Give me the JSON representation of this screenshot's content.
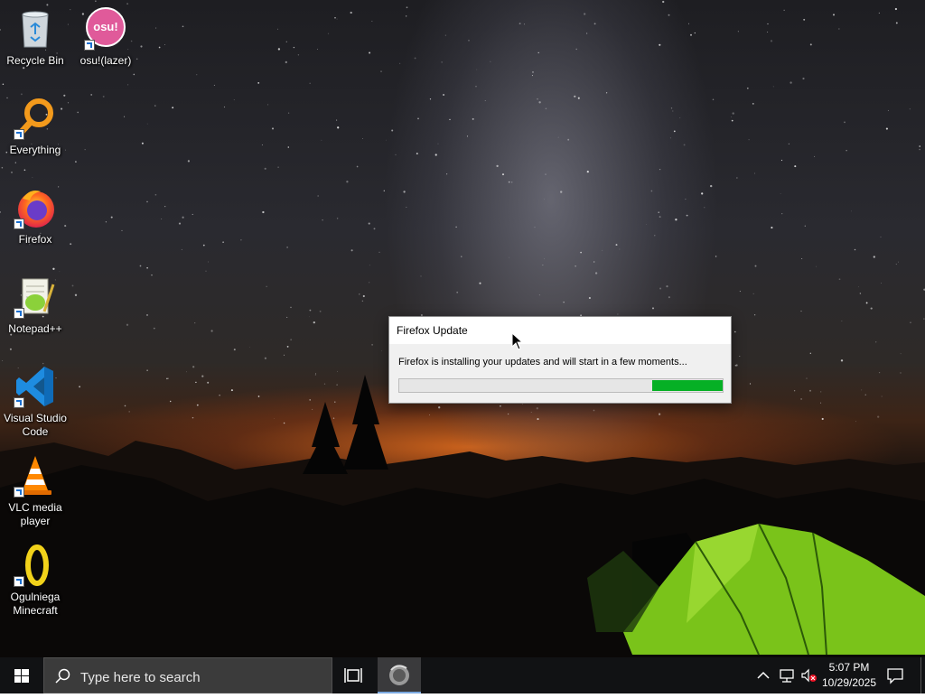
{
  "desktop_icons": [
    {
      "label": "Recycle Bin",
      "icon": "recycle-bin-icon"
    },
    {
      "label": "osu!(lazer)",
      "icon": "osu-icon",
      "badge_text": "osu!"
    },
    {
      "label": "Everything",
      "icon": "magnifier-icon"
    },
    {
      "label": "Firefox",
      "icon": "firefox-icon"
    },
    {
      "label": "Notepad++",
      "icon": "notepad-plus-plus-icon"
    },
    {
      "label": "Visual Studio Code",
      "icon": "vscode-icon"
    },
    {
      "label": "VLC media player",
      "icon": "vlc-cone-icon"
    },
    {
      "label": "Ogulniega Minecraft",
      "icon": "minecraft-launcher-icon"
    }
  ],
  "dialog": {
    "title": "Firefox Update",
    "message": "Firefox is installing your updates and will start in a few moments...",
    "progress_indeterminate": true,
    "progress_chunk_color": "#06b025"
  },
  "taskbar": {
    "search_placeholder": "Type here to search",
    "pinned": [
      {
        "name": "task-view-button",
        "icon": "task-view-icon"
      },
      {
        "name": "taskbar-firefox-updater",
        "icon": "firefox-updater-icon",
        "active": true
      }
    ],
    "tray": {
      "icons": [
        "chevron-up-icon",
        "network-icon",
        "volume-muted-icon"
      ],
      "time": "5:07 PM",
      "date": "10/29/2025"
    }
  },
  "colors": {
    "taskbar_bg": "#111214",
    "search_box_bg": "#3b3b3b",
    "dialog_bg": "#f0f0f0",
    "accent_blue": "#0078d7",
    "tent_green": "#7ac31a"
  }
}
